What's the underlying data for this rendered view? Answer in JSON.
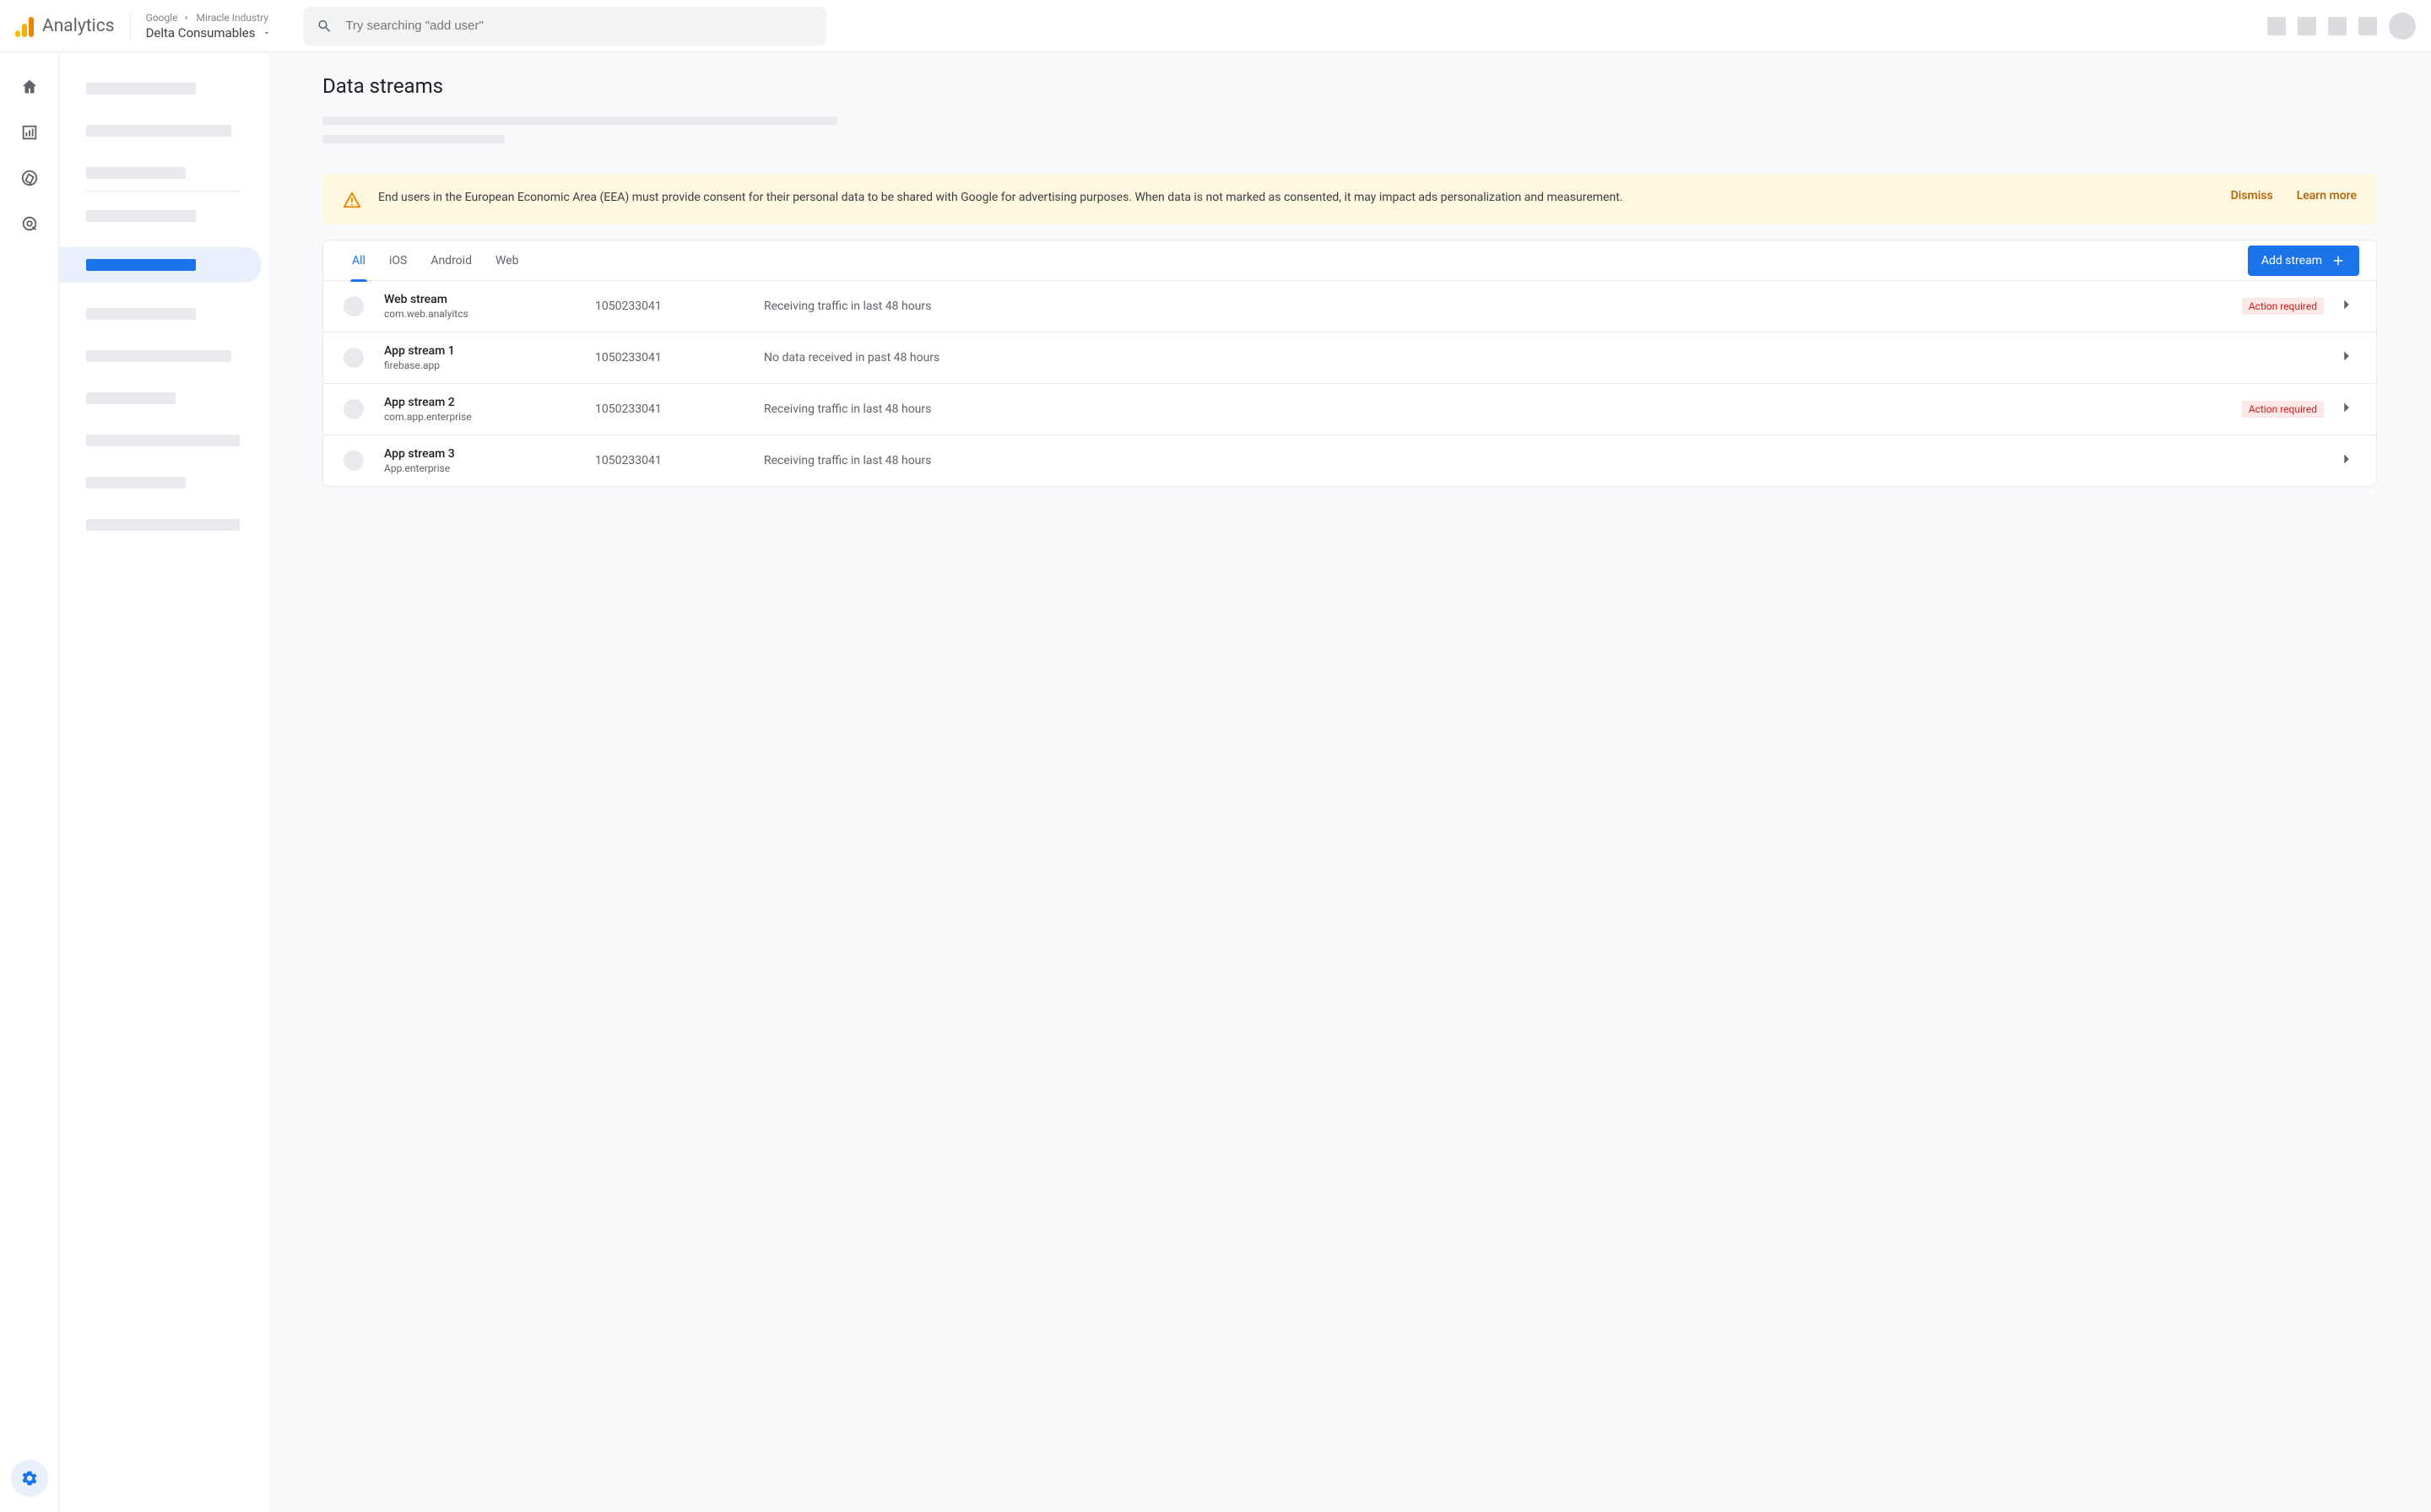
{
  "header": {
    "product": "Analytics",
    "breadcrumb_org": "Google",
    "breadcrumb_account": "Miracle Industry",
    "property": "Delta Consumables",
    "search_placeholder": "Try searching \"add user\""
  },
  "page": {
    "title": "Data streams"
  },
  "banner": {
    "text": "End users in the European Economic Area (EEA) must provide consent for their personal data to be shared with Google for advertising purposes. When data is not marked as consented, it may impact ads personalization and measurement.",
    "dismiss": "Dismiss",
    "learn_more": "Learn more"
  },
  "tabs": {
    "all": "All",
    "ios": "iOS",
    "android": "Android",
    "web": "Web"
  },
  "add_stream_label": "Add stream",
  "action_required_label": "Action required",
  "streams": [
    {
      "name": "Web stream",
      "sub": "com.web.analyitcs",
      "id": "1050233041",
      "status": "Receiving traffic in last 48 hours",
      "action_required": true
    },
    {
      "name": "App stream 1",
      "sub": "firebase.app",
      "id": "1050233041",
      "status": "No data received in past 48 hours",
      "action_required": false
    },
    {
      "name": "App stream 2",
      "sub": "com.app.enterprise",
      "id": "1050233041",
      "status": "Receiving traffic in last 48 hours",
      "action_required": true
    },
    {
      "name": "App stream 3",
      "sub": "App.enterprise",
      "id": "1050233041",
      "status": "Receiving traffic in last 48 hours",
      "action_required": false
    }
  ]
}
